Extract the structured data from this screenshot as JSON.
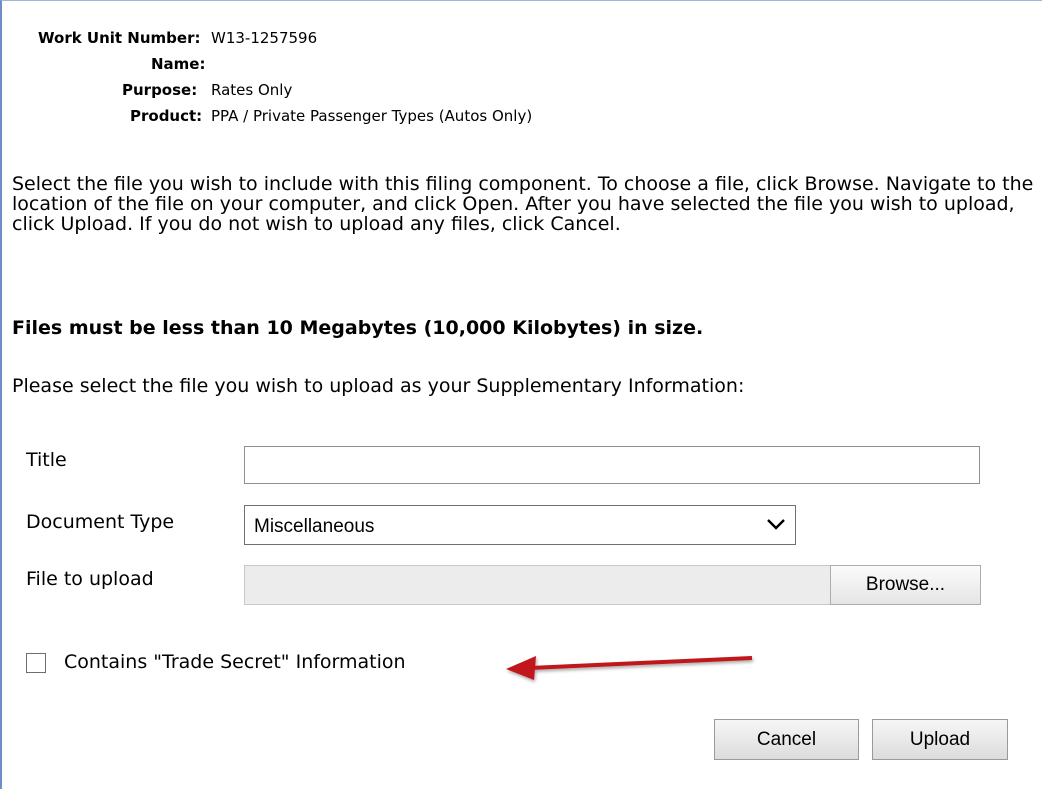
{
  "meta": {
    "work_unit_label": "Work Unit Number:",
    "work_unit_value": "W13-1257596",
    "name_label": "Name:",
    "name_value": "",
    "purpose_label": "Purpose:",
    "purpose_value": "Rates Only",
    "product_label": "Product:",
    "product_value": "PPA / Private Passenger Types (Autos Only)"
  },
  "instructions": "Select the file you wish to include with this filing component. To choose a file, click Browse. Navigate to the location of the file on your computer, and click Open. After you have selected the file you wish to upload, click Upload. If you do not wish to upload any files, click Cancel.",
  "size_warning": "Files must be less than 10 Megabytes (10,000 Kilobytes) in size.",
  "select_prompt": "Please select the file you wish to upload as your Supplementary Information:",
  "form": {
    "title_label": "Title",
    "title_value": "",
    "doc_type_label": "Document Type",
    "doc_type_value": "Miscellaneous",
    "file_label": "File to upload",
    "file_value": "",
    "browse_label": "Browse...",
    "trade_secret_label": "Contains \"Trade Secret\" Information",
    "trade_secret_checked": false
  },
  "buttons": {
    "cancel": "Cancel",
    "upload": "Upload"
  },
  "colors": {
    "arrow": "#c0161b",
    "frame_border": "#6b8fc4"
  },
  "icons": {
    "select": "chevron-down-icon",
    "annotation": "red-arrow-icon"
  }
}
